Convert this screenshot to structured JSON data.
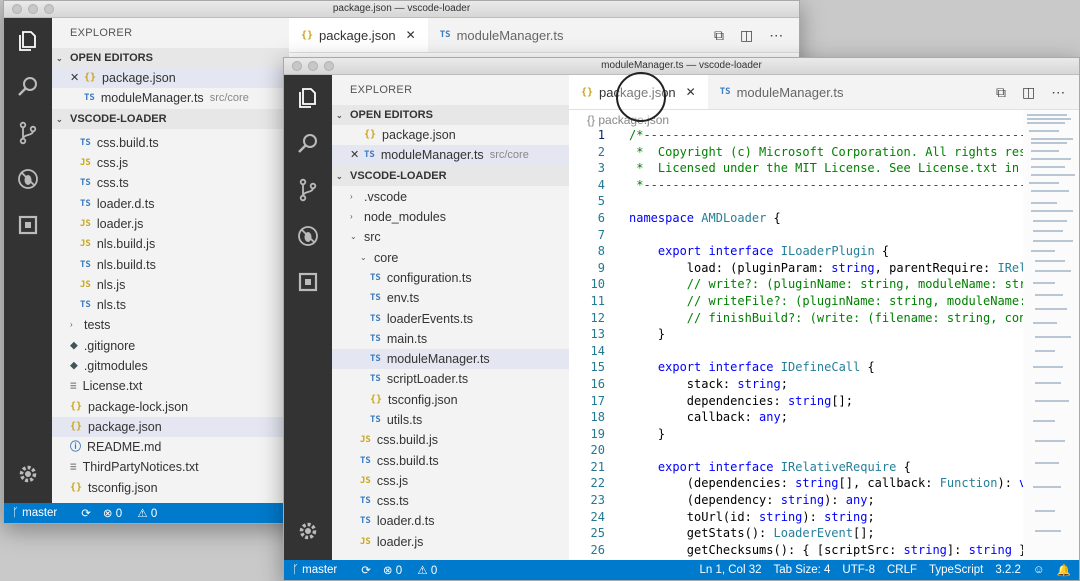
{
  "back_window": {
    "title": "package.json — vscode-loader",
    "explorer_title": "EXPLORER",
    "open_editors_label": "OPEN EDITORS",
    "open_editors": [
      {
        "close": "✕",
        "icon": "{}",
        "name": "package.json",
        "desc": "",
        "selected": true
      },
      {
        "close": "",
        "icon": "TS",
        "name": "moduleManager.ts",
        "desc": "src/core",
        "selected": false
      }
    ],
    "project_label": "VSCODE-LOADER",
    "files": [
      {
        "icon": "TS",
        "kind": "ts",
        "name": "css.build.ts",
        "indent": 1
      },
      {
        "icon": "JS",
        "kind": "js",
        "name": "css.js",
        "indent": 1
      },
      {
        "icon": "TS",
        "kind": "ts",
        "name": "css.ts",
        "indent": 1
      },
      {
        "icon": "TS",
        "kind": "ts",
        "name": "loader.d.ts",
        "indent": 1
      },
      {
        "icon": "JS",
        "kind": "js",
        "name": "loader.js",
        "indent": 1
      },
      {
        "icon": "JS",
        "kind": "js",
        "name": "nls.build.js",
        "indent": 1
      },
      {
        "icon": "TS",
        "kind": "ts",
        "name": "nls.build.ts",
        "indent": 1
      },
      {
        "icon": "JS",
        "kind": "js",
        "name": "nls.js",
        "indent": 1
      },
      {
        "icon": "TS",
        "kind": "ts",
        "name": "nls.ts",
        "indent": 1
      },
      {
        "icon": "›",
        "kind": "chev",
        "name": "tests",
        "indent": 0
      },
      {
        "icon": "◆",
        "kind": "git",
        "name": ".gitignore",
        "indent": 0
      },
      {
        "icon": "◆",
        "kind": "git",
        "name": ".gitmodules",
        "indent": 0
      },
      {
        "icon": "≡",
        "kind": "txt",
        "name": "License.txt",
        "indent": 0
      },
      {
        "icon": "{}",
        "kind": "json",
        "name": "package-lock.json",
        "indent": 0
      },
      {
        "icon": "{}",
        "kind": "json",
        "name": "package.json",
        "indent": 0,
        "selected": true
      },
      {
        "icon": "ⓘ",
        "kind": "info",
        "name": "README.md",
        "indent": 0
      },
      {
        "icon": "≡",
        "kind": "txt",
        "name": "ThirdPartyNotices.txt",
        "indent": 0
      },
      {
        "icon": "{}",
        "kind": "json",
        "name": "tsconfig.json",
        "indent": 0
      }
    ],
    "tabs": [
      {
        "icon": "{}",
        "label": "package.json",
        "close": "✕",
        "active": true
      },
      {
        "icon": "TS",
        "label": "moduleManager.ts",
        "close": "",
        "active": false
      }
    ],
    "status": {
      "branch": "master",
      "errors": "0",
      "warnings": "0"
    }
  },
  "front_window": {
    "title": "moduleManager.ts — vscode-loader",
    "explorer_title": "EXPLORER",
    "open_editors_label": "OPEN EDITORS",
    "open_editors": [
      {
        "close": "",
        "icon": "{}",
        "name": "package.json",
        "desc": "",
        "selected": false
      },
      {
        "close": "✕",
        "icon": "TS",
        "name": "moduleManager.ts",
        "desc": "src/core",
        "selected": true
      }
    ],
    "project_label": "VSCODE-LOADER",
    "files": [
      {
        "icon": "›",
        "kind": "chev",
        "name": ".vscode",
        "indent": 0
      },
      {
        "icon": "›",
        "kind": "chev",
        "name": "node_modules",
        "indent": 0
      },
      {
        "icon": "⌄",
        "kind": "chev",
        "name": "src",
        "indent": 0
      },
      {
        "icon": "⌄",
        "kind": "chev",
        "name": "core",
        "indent": 1
      },
      {
        "icon": "TS",
        "kind": "ts",
        "name": "configuration.ts",
        "indent": 2
      },
      {
        "icon": "TS",
        "kind": "ts",
        "name": "env.ts",
        "indent": 2
      },
      {
        "icon": "TS",
        "kind": "ts",
        "name": "loaderEvents.ts",
        "indent": 2
      },
      {
        "icon": "TS",
        "kind": "ts",
        "name": "main.ts",
        "indent": 2
      },
      {
        "icon": "TS",
        "kind": "ts",
        "name": "moduleManager.ts",
        "indent": 2,
        "selected": true
      },
      {
        "icon": "TS",
        "kind": "ts",
        "name": "scriptLoader.ts",
        "indent": 2
      },
      {
        "icon": "{}",
        "kind": "json",
        "name": "tsconfig.json",
        "indent": 2
      },
      {
        "icon": "TS",
        "kind": "ts",
        "name": "utils.ts",
        "indent": 2
      },
      {
        "icon": "JS",
        "kind": "js",
        "name": "css.build.js",
        "indent": 1
      },
      {
        "icon": "TS",
        "kind": "ts",
        "name": "css.build.ts",
        "indent": 1
      },
      {
        "icon": "JS",
        "kind": "js",
        "name": "css.js",
        "indent": 1
      },
      {
        "icon": "TS",
        "kind": "ts",
        "name": "css.ts",
        "indent": 1
      },
      {
        "icon": "TS",
        "kind": "ts",
        "name": "loader.d.ts",
        "indent": 1
      },
      {
        "icon": "JS",
        "kind": "js",
        "name": "loader.js",
        "indent": 1
      }
    ],
    "tabs": [
      {
        "icon": "{}",
        "label": "package.json",
        "close": "✕",
        "active": true
      },
      {
        "icon": "TS",
        "label": "moduleManager.ts",
        "close": "",
        "active": false
      }
    ],
    "breadcrumb": "{} package.json",
    "code_lines": [
      {
        "n": "1",
        "t": "/*---------------------------------------------------------------",
        "c": "cm"
      },
      {
        "n": "2",
        "t": " *  Copyright (c) Microsoft Corporation. All rights reserved.",
        "c": "cm"
      },
      {
        "n": "3",
        "t": " *  Licensed under the MIT License. See License.txt in the",
        "c": "cm"
      },
      {
        "n": "4",
        "t": " *---------------------------------------------------------------",
        "c": "cm"
      },
      {
        "n": "5",
        "t": "",
        "c": ""
      },
      {
        "n": "6",
        "t": "namespace AMDLoader {",
        "c": "ns"
      },
      {
        "n": "7",
        "t": "",
        "c": ""
      },
      {
        "n": "8",
        "t": "    export interface ILoaderPlugin {",
        "c": "iface"
      },
      {
        "n": "9",
        "t": "        load: (pluginParam: string, parentRequire: IRelative",
        "c": ""
      },
      {
        "n": "10",
        "t": "        // write?: (pluginName: string, moduleName: string,",
        "c": "cm"
      },
      {
        "n": "11",
        "t": "        // writeFile?: (pluginName: string, moduleName: str",
        "c": "cm"
      },
      {
        "n": "12",
        "t": "        // finishBuild?: (write: (filename: string, content",
        "c": "cm"
      },
      {
        "n": "13",
        "t": "    }",
        "c": ""
      },
      {
        "n": "14",
        "t": "",
        "c": ""
      },
      {
        "n": "15",
        "t": "    export interface IDefineCall {",
        "c": "iface"
      },
      {
        "n": "16",
        "t": "        stack: string;",
        "c": ""
      },
      {
        "n": "17",
        "t": "        dependencies: string[];",
        "c": ""
      },
      {
        "n": "18",
        "t": "        callback: any;",
        "c": ""
      },
      {
        "n": "19",
        "t": "    }",
        "c": ""
      },
      {
        "n": "20",
        "t": "",
        "c": ""
      },
      {
        "n": "21",
        "t": "    export interface IRelativeRequire {",
        "c": "iface"
      },
      {
        "n": "22",
        "t": "        (dependencies: string[], callback: Function): void;",
        "c": ""
      },
      {
        "n": "23",
        "t": "        (dependency: string): any;",
        "c": ""
      },
      {
        "n": "24",
        "t": "        toUrl(id: string): string;",
        "c": ""
      },
      {
        "n": "25",
        "t": "        getStats(): LoaderEvent[];",
        "c": ""
      },
      {
        "n": "26",
        "t": "        getChecksums(): { [scriptSrc: string]: string };",
        "c": ""
      }
    ],
    "status": {
      "branch": "master",
      "errors": "0",
      "warnings": "0",
      "position": "Ln 1, Col 32",
      "tab_size": "Tab Size: 4",
      "encoding": "UTF-8",
      "eol": "CRLF",
      "language": "TypeScript",
      "version": "3.2.2"
    }
  },
  "colors": {
    "status_bar": "#007acc",
    "activity_bar": "#333333"
  }
}
